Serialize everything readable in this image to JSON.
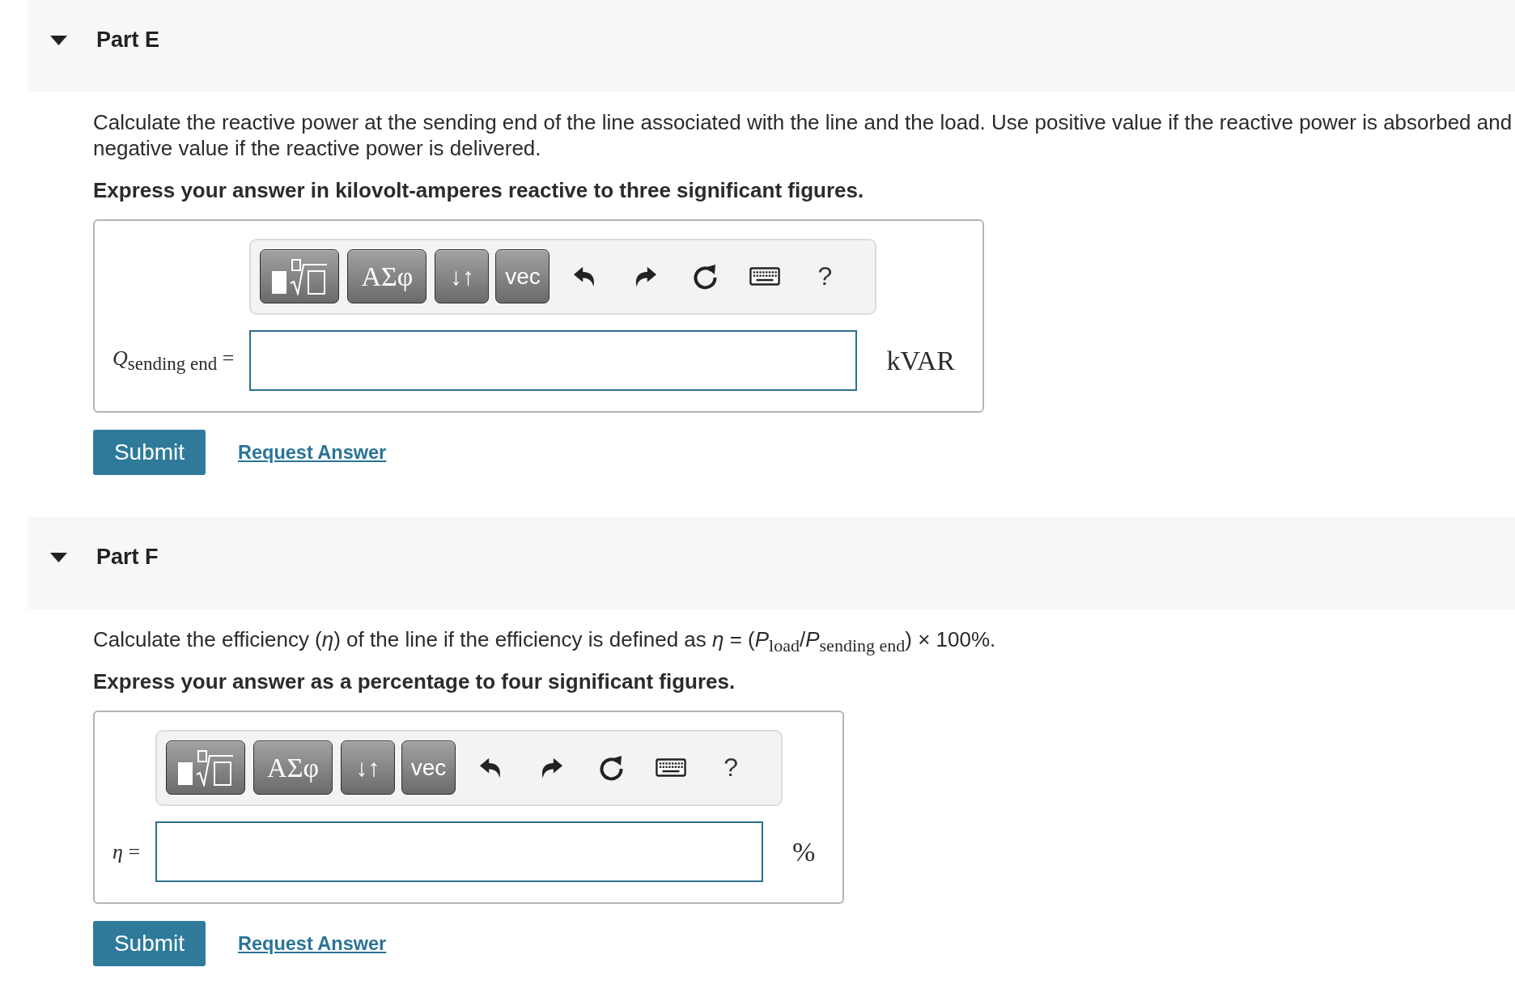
{
  "parts": [
    {
      "title": "Part E",
      "expanded": true,
      "question": "Calculate the reactive power at the sending end of the line associated with the line and the load. Use positive value if the reactive power is absorbed and negative value if the reactive power is delivered.",
      "instruction": "Express your answer in kilovolt-amperes reactive to three significant figures.",
      "toolbar": [
        {
          "kind": "templates"
        },
        {
          "kind": "greek",
          "label": "ΑΣφ"
        },
        {
          "kind": "arrows",
          "label": "↓↑"
        },
        {
          "kind": "vector",
          "label": "vec"
        },
        {
          "kind": "undo"
        },
        {
          "kind": "redo"
        },
        {
          "kind": "reset"
        },
        {
          "kind": "keyboard"
        },
        {
          "kind": "help",
          "label": "?"
        }
      ],
      "answer": {
        "label": "*Q*$_{sending end}$ =",
        "unit": "kVAR"
      },
      "actions": {
        "submit": "Submit",
        "request": "Request Answer"
      }
    },
    {
      "title": "Part F",
      "expanded": true,
      "question": "Calculate the efficiency (*η*) of the line if the efficiency is defined as *η* = (*P*$_{load}$/*P*$_{sending end}$) × 100%.",
      "instruction": "Express your answer as a percentage to four significant figures.",
      "toolbar": [
        {
          "kind": "templates"
        },
        {
          "kind": "greek",
          "label": "ΑΣφ"
        },
        {
          "kind": "arrows",
          "label": "↓↑"
        },
        {
          "kind": "vector",
          "label": "vec"
        },
        {
          "kind": "undo"
        },
        {
          "kind": "redo"
        },
        {
          "kind": "reset"
        },
        {
          "kind": "keyboard"
        },
        {
          "kind": "help",
          "label": "?"
        }
      ],
      "answer": {
        "label": "*η* =",
        "unit": "%"
      },
      "actions": {
        "submit": "Submit",
        "request": "Request Answer"
      }
    }
  ]
}
